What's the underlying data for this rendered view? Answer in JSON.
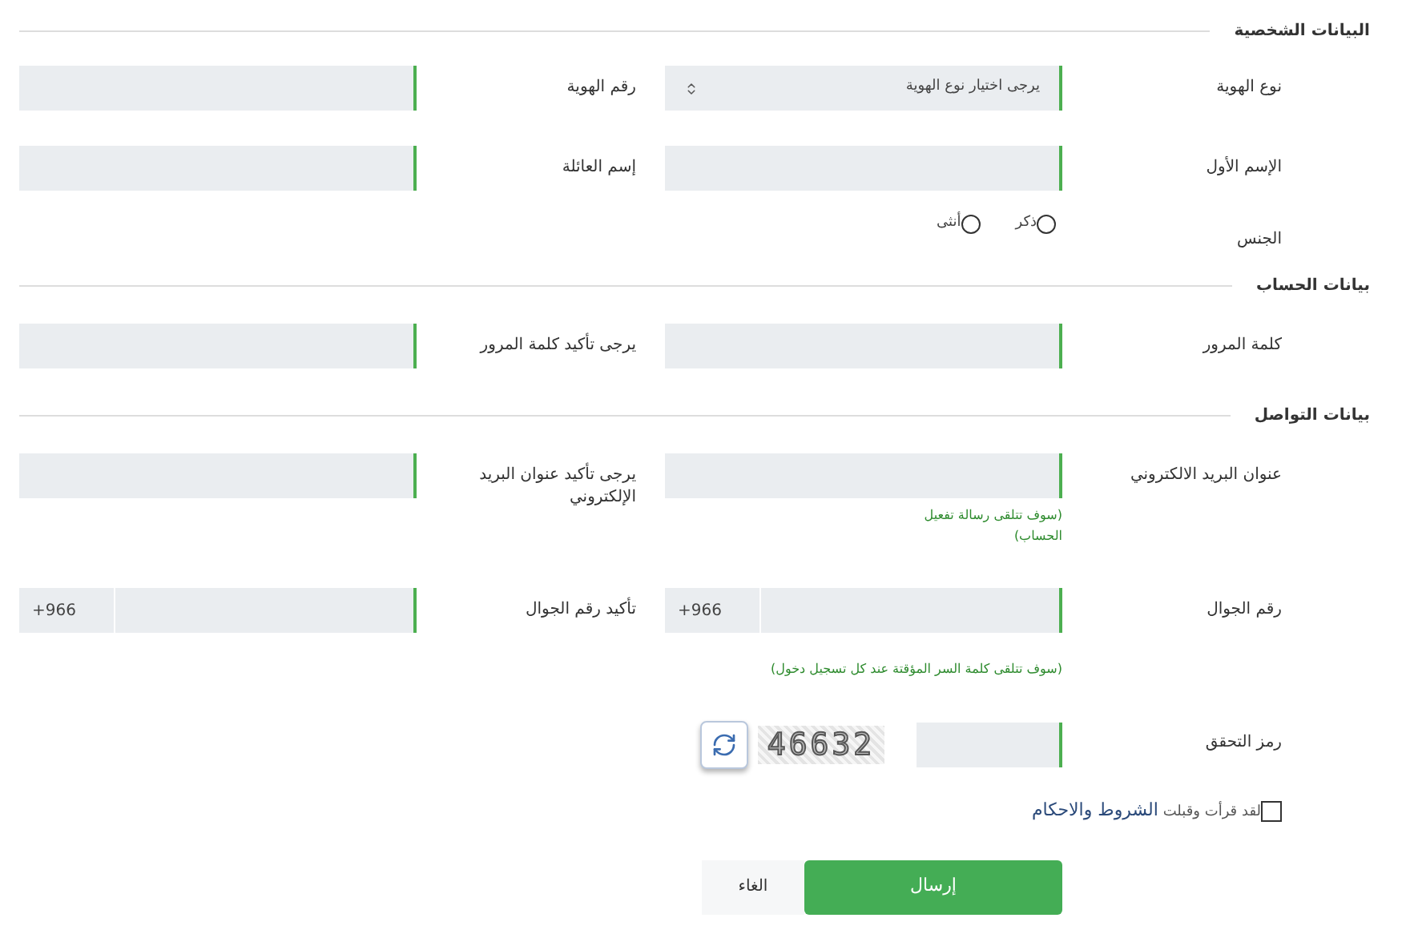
{
  "sections": [
    {
      "title": "البيانات الشخصية",
      "rows": [
        {
          "fields": [
            {
              "kind": "select",
              "label": "نوع الهوية",
              "value": "يرجى اختيار نوع الهوية"
            },
            {
              "kind": "text",
              "label": "رقم الهوية"
            }
          ]
        },
        {
          "fields": [
            {
              "kind": "text",
              "label": "الإسم الأول"
            },
            {
              "kind": "text",
              "label": "إسم العائلة"
            }
          ]
        },
        {
          "fields": [
            {
              "kind": "radio",
              "label": "الجنس",
              "options": [
                {
                  "label": "ذكر",
                  "selected": false
                },
                {
                  "label": "أنثى",
                  "selected": false
                }
              ]
            }
          ]
        }
      ]
    },
    {
      "title": "بيانات الحساب",
      "rows": [
        {
          "fields": [
            {
              "kind": "text",
              "label": "كلمة المرور"
            },
            {
              "kind": "text",
              "label": "يرجى تأكيد كلمة المرور"
            }
          ]
        }
      ]
    },
    {
      "title": "بيانات التواصل",
      "rows": [
        {
          "fields": [
            {
              "kind": "text",
              "label": "عنوان البريد الالكتروني",
              "hint": "(سوف تتلقى رسالة تفعيل الحساب)"
            },
            {
              "kind": "text",
              "label": "يرجى تأكيد عنوان البريد الإلكتروني"
            }
          ]
        },
        {
          "fields": [
            {
              "kind": "phone",
              "label": "رقم الجوال",
              "prefix": "+966",
              "hint": "(سوف تتلقى كلمة السر المؤقتة عند كل تسجيل دخول)"
            },
            {
              "kind": "phone",
              "label": "تأكيد رقم الجوال",
              "prefix": "+966"
            }
          ]
        },
        {
          "fields": [
            {
              "kind": "captcha",
              "label": "رمز التحقق",
              "code": "46632"
            }
          ]
        }
      ]
    }
  ],
  "terms": {
    "checked": false,
    "text": "لقد قرأت وقبلت",
    "link": "الشروط والاحكام"
  },
  "buttons": [
    {
      "kind": "primary",
      "label": "إرسال"
    },
    {
      "kind": "secondary",
      "label": "الغاء"
    }
  ]
}
